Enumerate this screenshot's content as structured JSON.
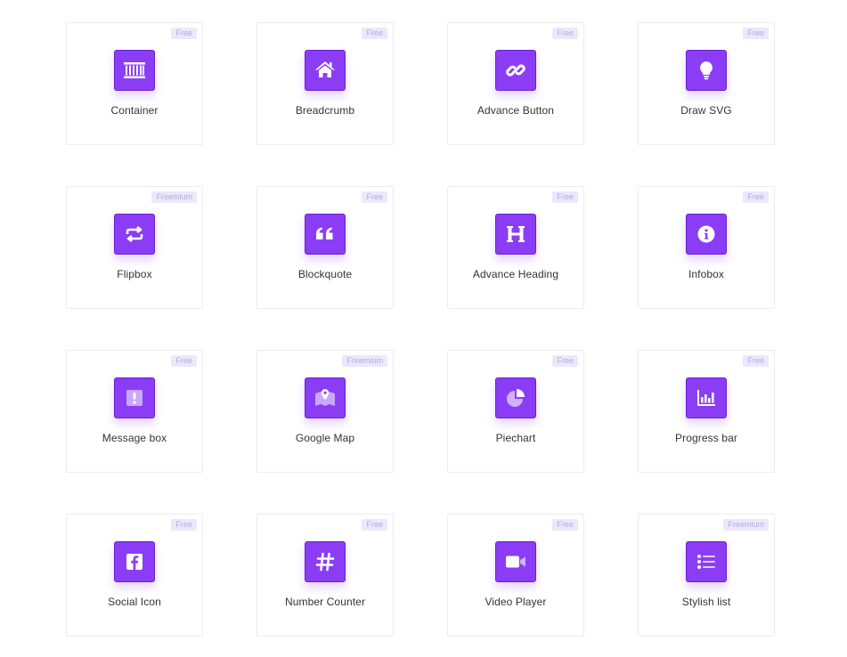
{
  "colors": {
    "accent": "#8b3df6",
    "badge_bg": "#ece8fb",
    "badge_text": "#b3a9e0"
  },
  "widgets": [
    {
      "label": "Container",
      "badge": "Free",
      "icon": "container-icon"
    },
    {
      "label": "Breadcrumb",
      "badge": "Free",
      "icon": "home-icon"
    },
    {
      "label": "Advance Button",
      "badge": "Free",
      "icon": "link-icon"
    },
    {
      "label": "Draw SVG",
      "badge": "Free",
      "icon": "lightbulb-icon"
    },
    {
      "label": "Flipbox",
      "badge": "Freemium",
      "icon": "repeat-icon"
    },
    {
      "label": "Blockquote",
      "badge": "Free",
      "icon": "quote-icon"
    },
    {
      "label": "Advance Heading",
      "badge": "Free",
      "icon": "heading-icon"
    },
    {
      "label": "Infobox",
      "badge": "Free",
      "icon": "info-icon"
    },
    {
      "label": "Message box",
      "badge": "Free",
      "icon": "alert-icon"
    },
    {
      "label": "Google Map",
      "badge": "Freemium",
      "icon": "map-icon"
    },
    {
      "label": "Piechart",
      "badge": "Free",
      "icon": "pie-chart-icon"
    },
    {
      "label": "Progress bar",
      "badge": "Free",
      "icon": "bar-chart-icon"
    },
    {
      "label": "Social Icon",
      "badge": "Free",
      "icon": "facebook-icon"
    },
    {
      "label": "Number Counter",
      "badge": "Free",
      "icon": "hashtag-icon"
    },
    {
      "label": "Video Player",
      "badge": "Free",
      "icon": "video-icon"
    },
    {
      "label": "Stylish list",
      "badge": "Freemium",
      "icon": "list-icon"
    }
  ]
}
